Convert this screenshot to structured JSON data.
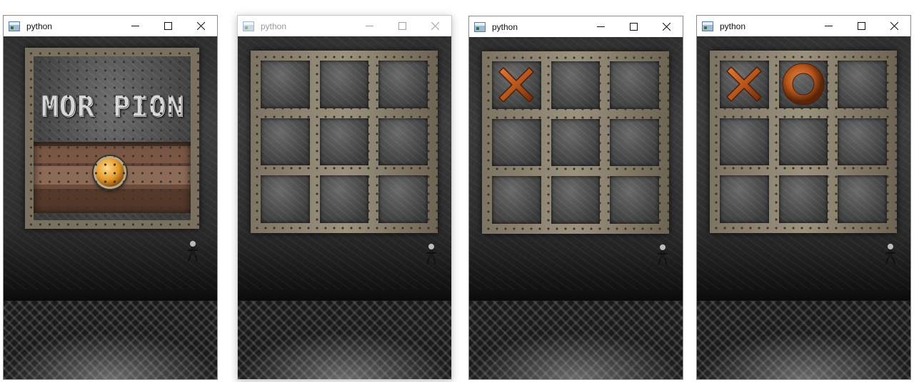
{
  "windows": [
    {
      "title": "python",
      "active": true,
      "screen": "title",
      "logo_text": "MOR PION"
    },
    {
      "title": "python",
      "active": false,
      "screen": "board",
      "board": [
        "",
        "",
        "",
        "",
        "",
        "",
        "",
        "",
        ""
      ]
    },
    {
      "title": "python",
      "active": true,
      "screen": "board",
      "board": [
        "X",
        "",
        "",
        "",
        "",
        "",
        "",
        "",
        ""
      ]
    },
    {
      "title": "python",
      "active": true,
      "screen": "board",
      "board": [
        "X",
        "O",
        "",
        "",
        "",
        "",
        "",
        "",
        ""
      ]
    }
  ],
  "icons": {
    "minimize": "minimize-icon",
    "maximize": "maximize-icon",
    "close": "close-icon",
    "app": "python-app-icon"
  },
  "colors": {
    "x_mark": "#b8561c",
    "o_mark": "#b8561c",
    "start_button": "#e39a2a"
  }
}
